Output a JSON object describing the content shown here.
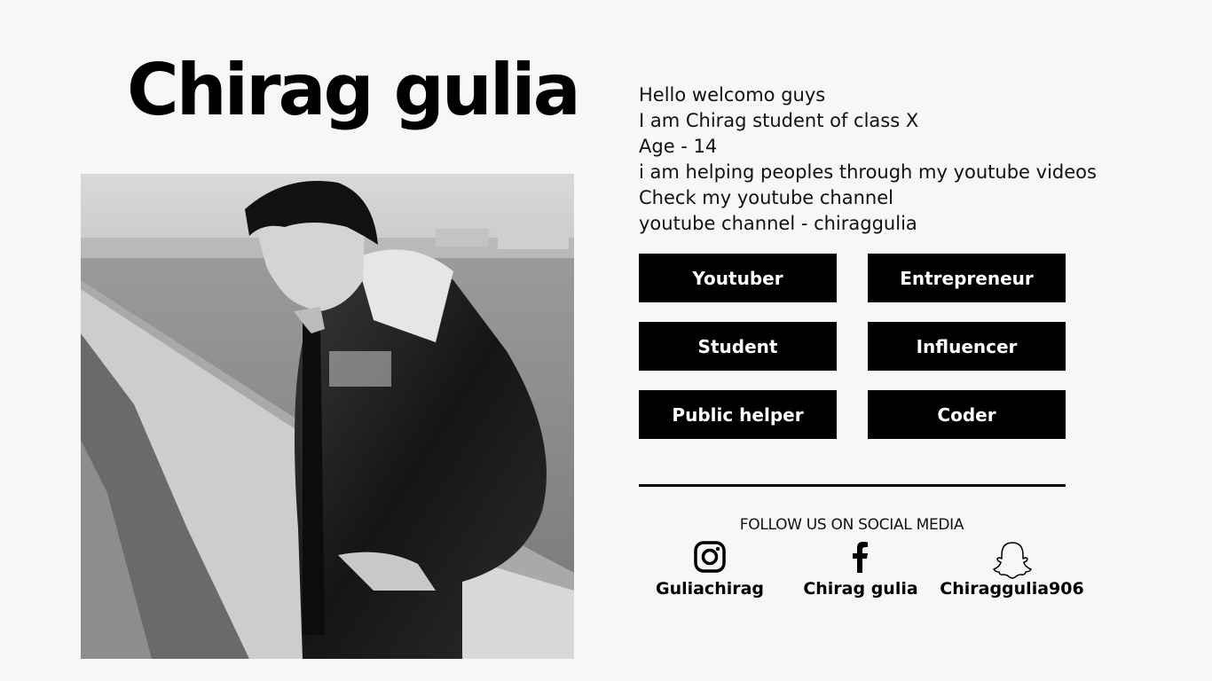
{
  "header": {
    "name": "Chirag gulia"
  },
  "photo": {
    "description_icon": "portrait-photo"
  },
  "bio": {
    "lines": [
      "Hello welcomo guys",
      "I am Chirag student of class X",
      "Age - 14",
      "i am helping peoples through my youtube videos",
      "Check my youtube channel",
      "youtube channel - chiraggulia"
    ]
  },
  "roles": [
    {
      "label": "Youtuber"
    },
    {
      "label": "Entrepreneur"
    },
    {
      "label": "Student"
    },
    {
      "label": "Influencer"
    },
    {
      "label": "Public helper"
    },
    {
      "label": "Coder"
    }
  ],
  "social": {
    "heading": "FOLLOW US ON SOCIAL MEDIA",
    "accounts": [
      {
        "icon": "instagram-icon",
        "handle": "Guliachirag"
      },
      {
        "icon": "facebook-icon",
        "handle": "Chirag gulia"
      },
      {
        "icon": "snapchat-icon",
        "handle": "Chiraggulia906"
      }
    ]
  },
  "colors": {
    "background": "#f7f7f7",
    "button": "#000000",
    "button_text": "#ffffff"
  }
}
